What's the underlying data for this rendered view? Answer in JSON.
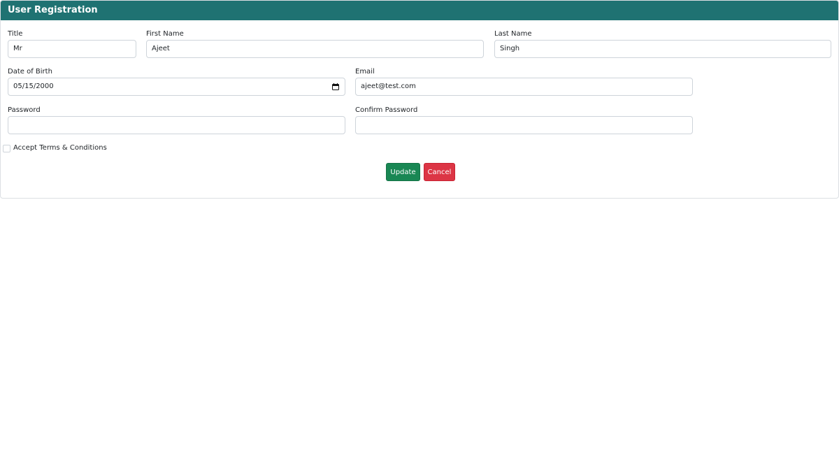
{
  "form": {
    "header_title": "User Registration",
    "title": {
      "label": "Title",
      "value": "Mr"
    },
    "first_name": {
      "label": "First Name",
      "value": "Ajeet"
    },
    "last_name": {
      "label": "Last Name",
      "value": "Singh"
    },
    "dob": {
      "label": "Date of Birth",
      "value": "05/15/2000",
      "icon": "calendar-icon"
    },
    "email": {
      "label": "Email",
      "value": "ajeet@test.com"
    },
    "password": {
      "label": "Password",
      "value": ""
    },
    "confirm_password": {
      "label": "Confirm Password",
      "value": ""
    },
    "terms": {
      "label": "Accept Terms & Conditions",
      "checked": false
    },
    "update_label": "Update",
    "cancel_label": "Cancel"
  },
  "colors": {
    "header": "#1f7272",
    "update_button": "#198754",
    "cancel_button": "#dc3545"
  }
}
